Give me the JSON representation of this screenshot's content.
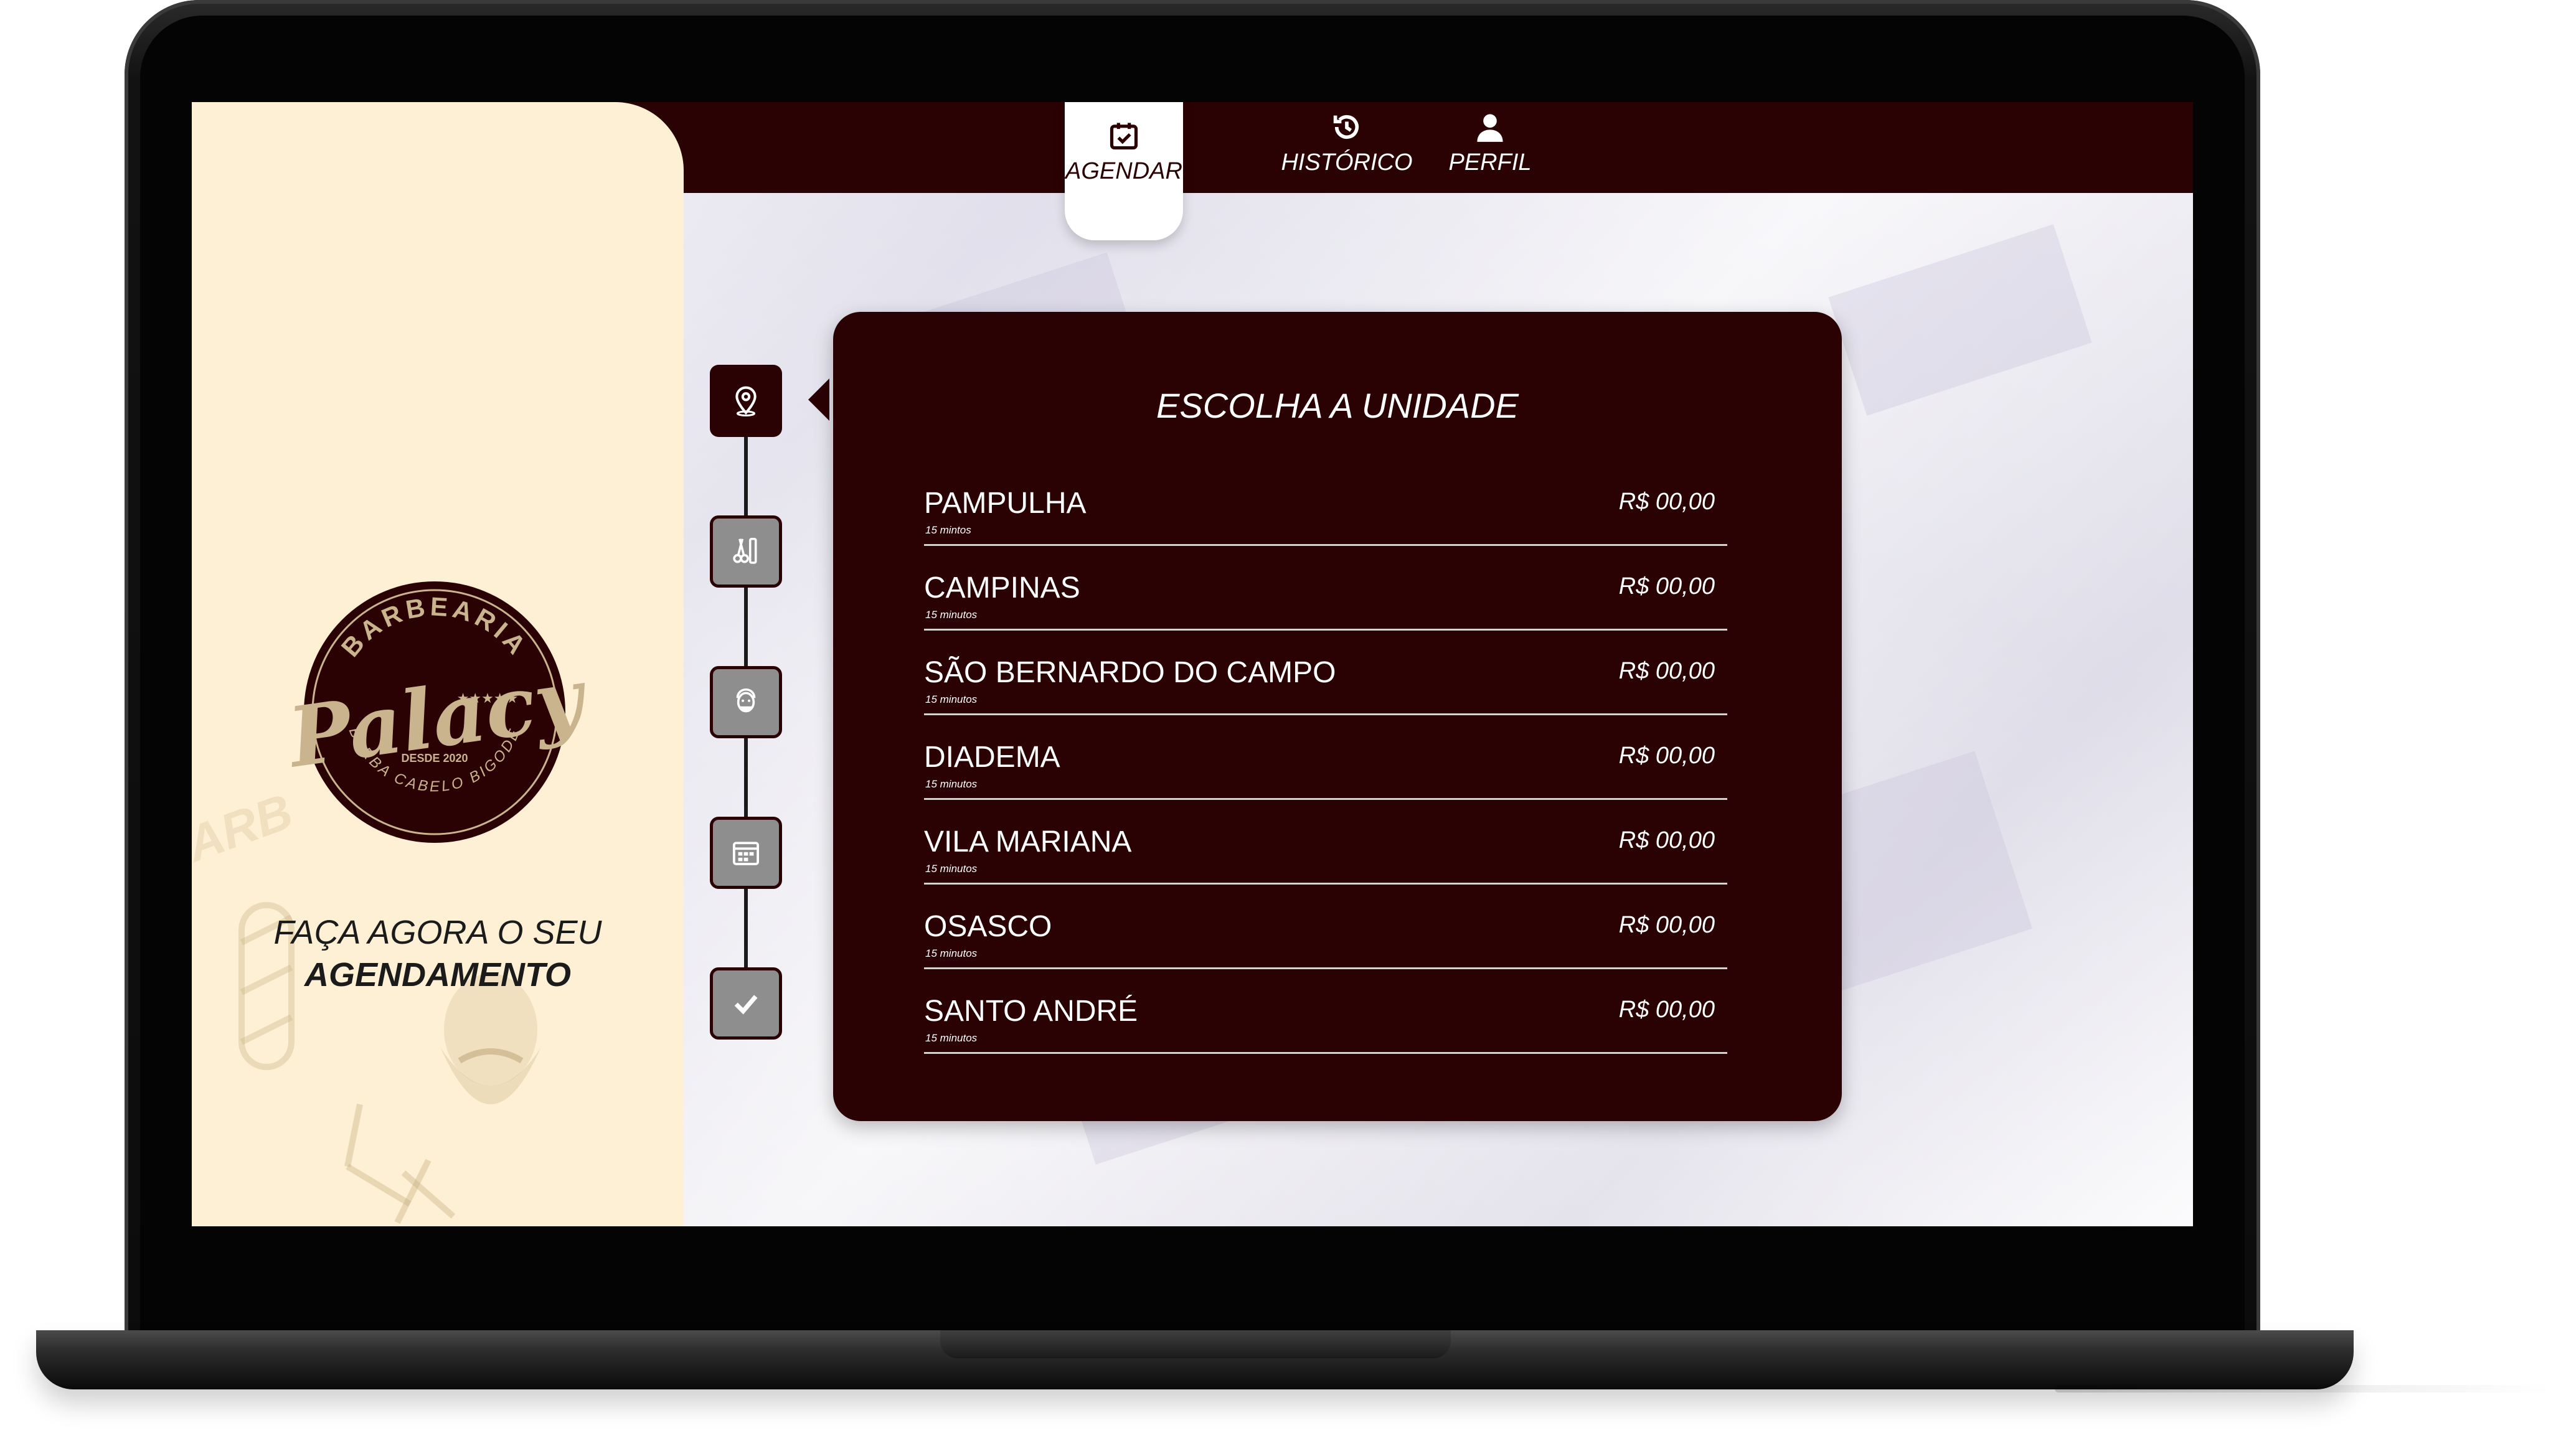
{
  "colors": {
    "brand_dark": "#2b0204",
    "sidebar_bg": "#fdf0d4",
    "step_idle": "#8e8e8e",
    "text_light": "#ffffff"
  },
  "nav": {
    "items": [
      {
        "label": "AGENDAR",
        "icon": "calendar-check-icon",
        "active": true
      },
      {
        "label": "HISTÓRICO",
        "icon": "history-icon",
        "active": false
      },
      {
        "label": "PERFIL",
        "icon": "user-icon",
        "active": false
      }
    ]
  },
  "sidebar": {
    "logo": {
      "top_text": "BARBEARIA",
      "name": "Palacy",
      "since": "DESDE 2020",
      "bottom_text": "BARBA CABELO BIGODE",
      "stars": "★★★★★"
    },
    "cta_line1": "FAÇA AGORA O SEU",
    "cta_line2": "AGENDAMENTO"
  },
  "stepper": {
    "steps": [
      {
        "icon": "location-pin-icon",
        "active": true
      },
      {
        "icon": "scissors-comb-icon",
        "active": false
      },
      {
        "icon": "barber-face-icon",
        "active": false
      },
      {
        "icon": "calendar-icon",
        "active": false
      },
      {
        "icon": "checkmark-icon",
        "active": false
      }
    ]
  },
  "card": {
    "title": "ESCOLHA A UNIDADE",
    "units": [
      {
        "name": "PAMPULHA",
        "duration": "15 mintos",
        "price": "R$ 00,00"
      },
      {
        "name": "CAMPINAS",
        "duration": "15 minutos",
        "price": "R$ 00,00"
      },
      {
        "name": "SÃO BERNARDO DO CAMPO",
        "duration": "15 minutos",
        "price": "R$ 00,00"
      },
      {
        "name": "DIADEMA",
        "duration": "15 minutos",
        "price": "R$ 00,00"
      },
      {
        "name": "VILA MARIANA",
        "duration": "15 minutos",
        "price": "R$ 00,00"
      },
      {
        "name": "OSASCO",
        "duration": "15 minutos",
        "price": "R$ 00,00"
      },
      {
        "name": "SANTO ANDRÉ",
        "duration": "15 minutos",
        "price": "R$ 00,00"
      }
    ]
  }
}
